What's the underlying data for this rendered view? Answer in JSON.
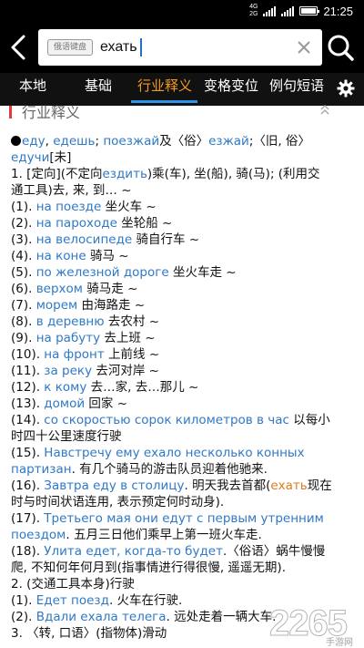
{
  "status_bar": {
    "network": "4G",
    "network2": "2G",
    "time": "21:25"
  },
  "search": {
    "keyboard_badge": "俄语键盘",
    "query": "ехать"
  },
  "tabs": [
    {
      "label": "本地"
    },
    {
      "label": "基础"
    },
    {
      "label": "行业释义",
      "active": true
    },
    {
      "label": "变格变位"
    },
    {
      "label": "例句短语"
    }
  ],
  "section": {
    "title": "行业释义"
  },
  "entry": {
    "forms": {
      "f1": "еду",
      "sep1": ", ",
      "f2": "едешь",
      "sep2": "; ",
      "f3": "поезжай",
      "mid": "及〈俗〉",
      "f4": "езжай",
      "tail": ";〈旧, 俗〉",
      "f5": "едучи",
      "tag": "[未]"
    },
    "lines": [
      {
        "pre": "1. [定向](不定向",
        "ru": "ездить",
        "post": ")乘(车), 坐(船), 骑(马); (利用交"
      },
      {
        "pre": "通工具)去, 来, 到… ~",
        "ru": "",
        "post": ""
      },
      {
        "pre": "(1). ",
        "ru": "на поезде",
        "post": " 坐火车 ~"
      },
      {
        "pre": "(2). ",
        "ru": "на пароходе",
        "post": " 坐轮船 ~"
      },
      {
        "pre": "(3). ",
        "ru": "на велосипеде",
        "post": " 骑自行车 ~"
      },
      {
        "pre": "(4). ",
        "ru": "на коне",
        "post": " 骑马 ~"
      },
      {
        "pre": "(5). ",
        "ru": "по железной дороге",
        "post": " 坐火车走 ~"
      },
      {
        "pre": "(6). ",
        "ru": "верхом",
        "post": " 骑马走 ~"
      },
      {
        "pre": "(7). ",
        "ru": "морем",
        "post": " 由海路走 ~"
      },
      {
        "pre": "(8). ",
        "ru": "в деревню",
        "post": " 去农村 ~"
      },
      {
        "pre": "(9). ",
        "ru": "на рабуту",
        "post": " 去上班 ~"
      },
      {
        "pre": "(10). ",
        "ru": "на фронт",
        "post": " 上前线 ~"
      },
      {
        "pre": "(11). ",
        "ru": "за реку",
        "post": " 去河对岸 ~"
      },
      {
        "pre": "(12). ",
        "ru": "к кому",
        "post": " 去…家, 去…那儿 ~"
      },
      {
        "pre": "(13). ",
        "ru": "домой",
        "post": " 回家 ~"
      },
      {
        "pre": "(14). ",
        "ru": "со скоростью сорок километров в час",
        "post": " 以每小"
      },
      {
        "pre": "时四十公里速度行驶",
        "ru": "",
        "post": ""
      },
      {
        "pre": "(15). ",
        "ru": "Навстречу ему ехало несколько конных",
        "post": ""
      },
      {
        "pre": "",
        "ru": "партизан",
        "post": ". 有几个骑马的游击队员迎着他驰来."
      },
      {
        "pre": "(16). ",
        "ru": "Завтра еду в столицу",
        "post": ". 明天我去首都(",
        "hl": "ехать",
        "post2": "现在"
      },
      {
        "pre": "时与时间状语连用, 表示预定何时动身).",
        "ru": "",
        "post": ""
      },
      {
        "pre": "(17). ",
        "ru": "Третьего мая они едут с первым утренним",
        "post": ""
      },
      {
        "pre": "",
        "ru": "поездом",
        "post": ". 五月三日他们乘早上第一班火车走."
      },
      {
        "pre": "(18). ",
        "ru": "Улита едет, когда-то будет",
        "post": ".〈俗语〉蜗牛慢慢"
      },
      {
        "pre": "爬, 不知何年何月到(指事情进行得很慢, 遥遥无期).",
        "ru": "",
        "post": ""
      },
      {
        "pre": "2. (交通工具本身)行驶",
        "ru": "",
        "post": ""
      },
      {
        "pre": "(1). ",
        "ru": "Едет поезд",
        "post": ". 火车在行驶."
      },
      {
        "pre": "(2). ",
        "ru": "Вдали ехала телега",
        "post": ". 远处走着一辆大车."
      },
      {
        "pre": "3. 〈转, 口语〉(指物体)滑动",
        "ru": "",
        "post": ""
      }
    ]
  },
  "watermark": {
    "brand": "2265",
    "site": "手游网"
  }
}
